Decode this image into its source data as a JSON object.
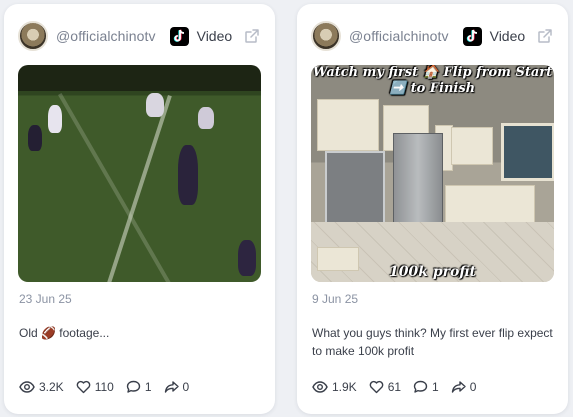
{
  "posts": [
    {
      "handle": "@officialchinotv",
      "type_label": "Video",
      "date": "23 Jun 25",
      "caption": "Old 🏈 footage...",
      "stats": {
        "views": "3.2K",
        "likes": "110",
        "comments": "1",
        "shares": "0"
      }
    },
    {
      "handle": "@officialchinotv",
      "type_label": "Video",
      "date": "9 Jun 25",
      "caption": "What you guys think? My first ever flip expect to make 100k profit",
      "overlay_top": "Watch my first 🏠 Flip from Start ➡️ to Finish",
      "overlay_bottom": "100k profit",
      "stats": {
        "views": "1.9K",
        "likes": "61",
        "comments": "1",
        "shares": "0"
      }
    }
  ],
  "icons": {
    "platform": "tiktok-icon",
    "open": "external-link-icon",
    "views": "eye-icon",
    "likes": "heart-icon",
    "comments": "comment-icon",
    "shares": "share-icon"
  },
  "colors": {
    "card_bg": "#ffffff",
    "page_bg": "#eef0f4",
    "muted_text": "#8b93a3",
    "body_text": "#3a3f4a"
  }
}
